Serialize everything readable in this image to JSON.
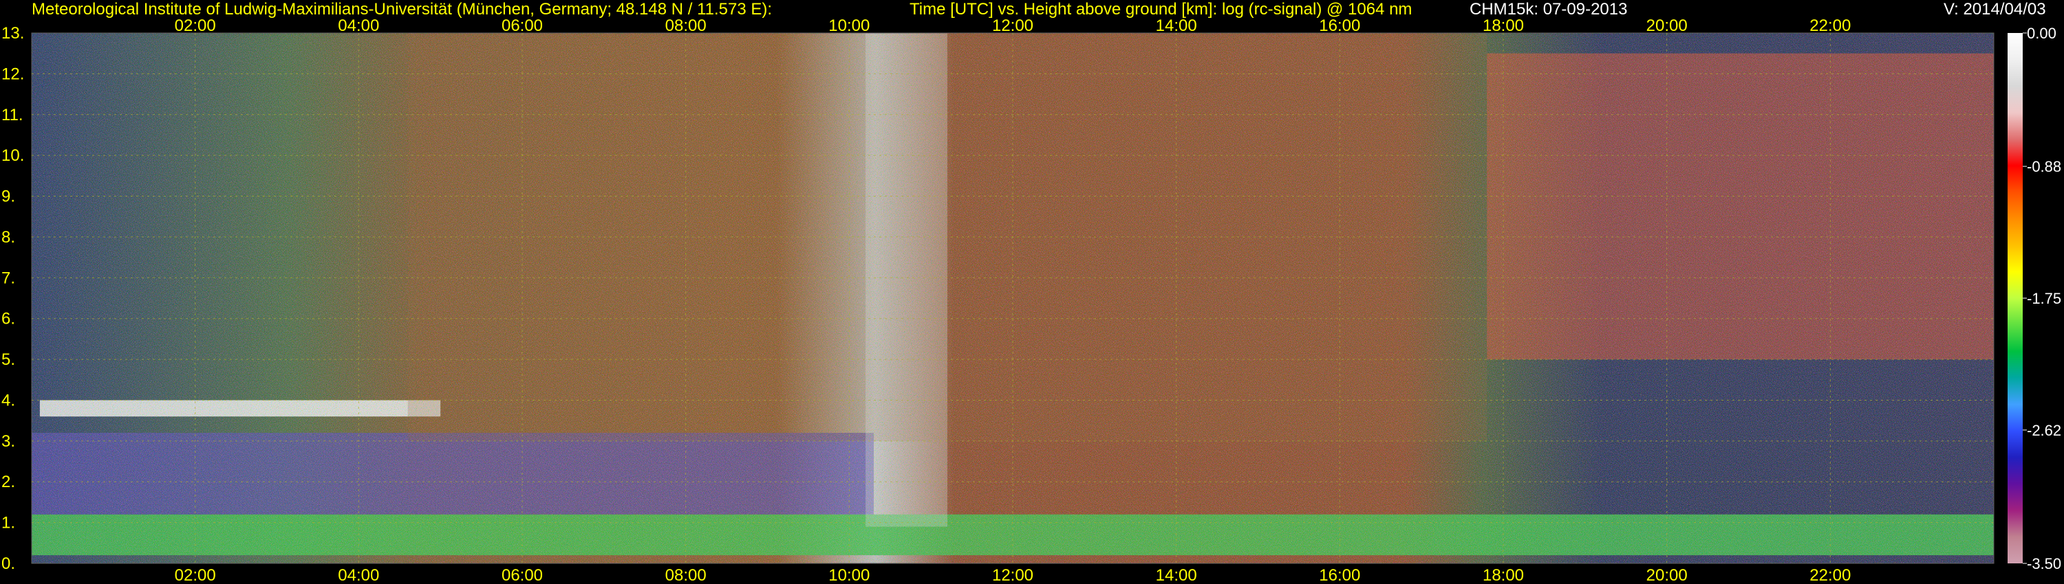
{
  "header": {
    "institute": "Meteorological Institute of Ludwig-Maximilians-Universität (München, Germany; 48.148 N / 11.573 E):",
    "axis_desc": "Time [UTC] vs. Height above ground [km]: log (rc-signal) @ 1064 nm",
    "instrument": "CHM15k: 07-09-2013",
    "version": "V: 2014/04/03"
  },
  "colors": {
    "header_text": "#ffff00",
    "axis_text": "#ffff00",
    "background": "#000000",
    "grid": "#b0b030"
  },
  "chart_data": {
    "type": "heatmap",
    "xlabel": "",
    "ylabel": "",
    "x_range_hours": [
      0,
      24
    ],
    "x_ticks": [
      "02:00",
      "04:00",
      "06:00",
      "08:00",
      "10:00",
      "12:00",
      "14:00",
      "16:00",
      "18:00",
      "20:00",
      "22:00"
    ],
    "x_tick_hours": [
      2,
      4,
      6,
      8,
      10,
      12,
      14,
      16,
      18,
      20,
      22
    ],
    "y_range_km": [
      0,
      13
    ],
    "y_ticks": [
      "0.",
      "1.",
      "2.",
      "3.",
      "4.",
      "5.",
      "6.",
      "7.",
      "8.",
      "9.",
      "10.",
      "11.",
      "12.",
      "13."
    ],
    "grid": true,
    "colorbar": {
      "range": [
        -3.5,
        0.0
      ],
      "ticks": [
        "0.00",
        "-0.88",
        "-1.75",
        "-2.62",
        "-3.50"
      ],
      "tick_values": [
        0.0,
        -0.88,
        -1.75,
        -2.62,
        -3.5
      ],
      "colors": [
        "#ffffff",
        "#f0f0f0",
        "#d8d8d8",
        "#f0c8c8",
        "#e07070",
        "#ff0000",
        "#ff5000",
        "#ff8c00",
        "#ffc000",
        "#ffff00",
        "#c0ff40",
        "#60e040",
        "#00c040",
        "#00a8a0",
        "#40a0ff",
        "#3050ff",
        "#2020c0",
        "#6010a0",
        "#a02080",
        "#c08090",
        "#d0a0b0"
      ]
    },
    "features": [
      {
        "name": "boundary-layer",
        "hours": [
          0,
          24
        ],
        "km": [
          0.2,
          1.2
        ]
      },
      {
        "name": "residual-layer",
        "hours": [
          0,
          10.3
        ],
        "km": [
          1.2,
          3.2
        ]
      },
      {
        "name": "cloud-layer",
        "hours": [
          0.1,
          5
        ],
        "km": [
          3.6,
          4.0
        ]
      },
      {
        "name": "noise-daytime",
        "hours": [
          4.6,
          17.8
        ],
        "km": [
          3.0,
          13.0
        ]
      },
      {
        "name": "clouds",
        "hours": [
          10.2,
          11.2
        ],
        "km": [
          0.9,
          13.0
        ]
      },
      {
        "name": "cirrus",
        "hours": [
          17.8,
          24
        ],
        "km": [
          5,
          12.5
        ]
      }
    ]
  }
}
